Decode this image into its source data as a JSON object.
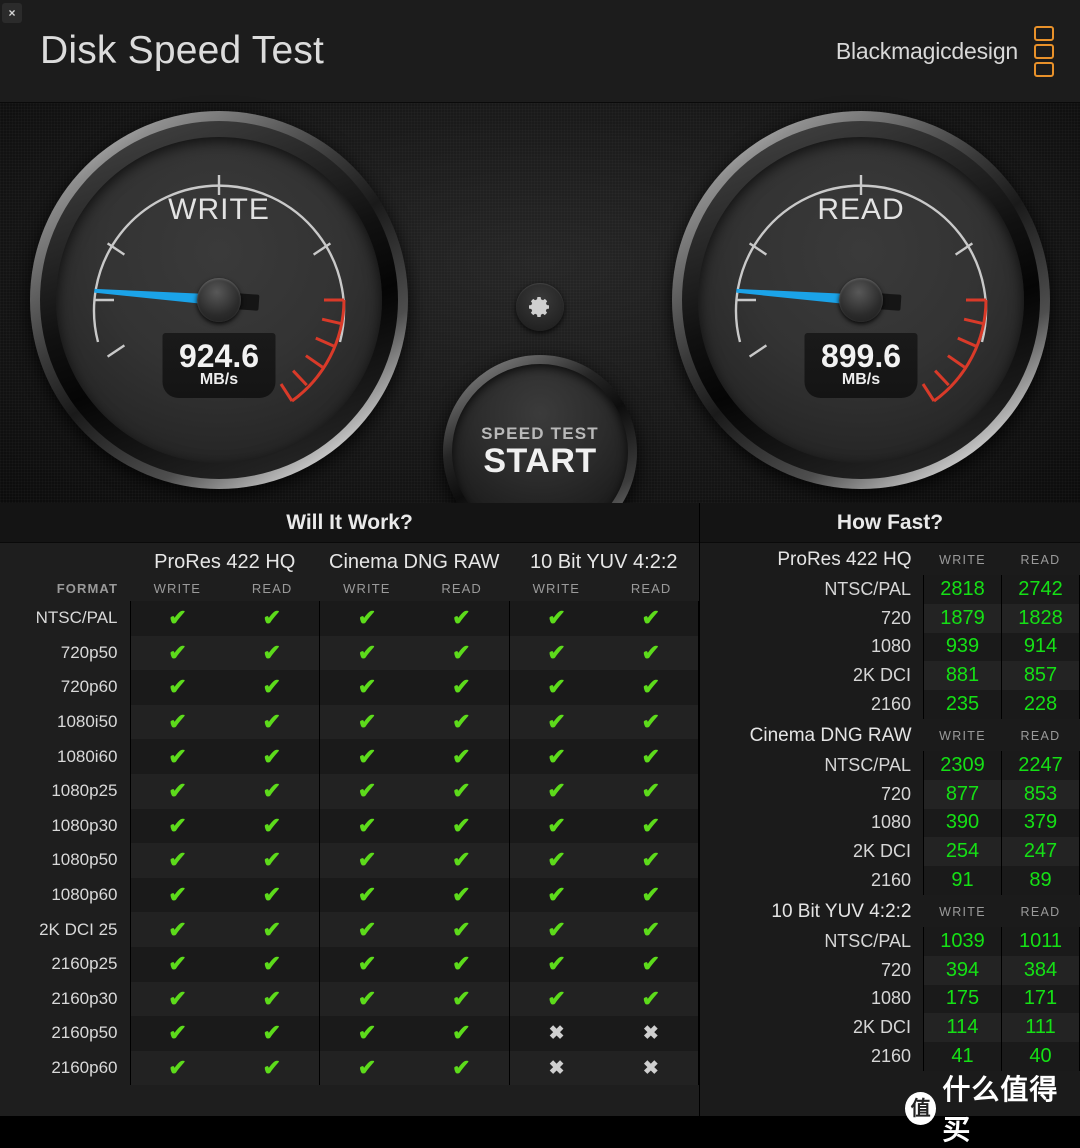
{
  "window": {
    "close_label": "×"
  },
  "header": {
    "title": "Disk Speed Test",
    "brand": "Blackmagicdesign",
    "brand_color": "#e8912a"
  },
  "gauges": {
    "write": {
      "label": "WRITE",
      "value": "924.6",
      "unit": "MB/s",
      "needle_color": "#1ba3e8",
      "needle_angle": 184
    },
    "read": {
      "label": "READ",
      "value": "899.6",
      "unit": "MB/s",
      "needle_color": "#1ba3e8",
      "needle_angle": 184
    }
  },
  "start_button": {
    "sub_label": "SPEED TEST",
    "main_label": "START"
  },
  "settings_button": {
    "icon": "gear-icon"
  },
  "will_it_work": {
    "title": "Will It Work?",
    "format_header": "FORMAT",
    "groups": [
      "ProRes 422 HQ",
      "Cinema DNG RAW",
      "10 Bit YUV 4:2:2"
    ],
    "sub_headers": [
      "WRITE",
      "READ"
    ],
    "check_glyph": "✔",
    "cross_glyph": "✖",
    "rows": [
      {
        "format": "NTSC/PAL",
        "marks": [
          true,
          true,
          true,
          true,
          true,
          true
        ]
      },
      {
        "format": "720p50",
        "marks": [
          true,
          true,
          true,
          true,
          true,
          true
        ]
      },
      {
        "format": "720p60",
        "marks": [
          true,
          true,
          true,
          true,
          true,
          true
        ]
      },
      {
        "format": "1080i50",
        "marks": [
          true,
          true,
          true,
          true,
          true,
          true
        ]
      },
      {
        "format": "1080i60",
        "marks": [
          true,
          true,
          true,
          true,
          true,
          true
        ]
      },
      {
        "format": "1080p25",
        "marks": [
          true,
          true,
          true,
          true,
          true,
          true
        ]
      },
      {
        "format": "1080p30",
        "marks": [
          true,
          true,
          true,
          true,
          true,
          true
        ]
      },
      {
        "format": "1080p50",
        "marks": [
          true,
          true,
          true,
          true,
          true,
          true
        ]
      },
      {
        "format": "1080p60",
        "marks": [
          true,
          true,
          true,
          true,
          true,
          true
        ]
      },
      {
        "format": "2K DCI 25",
        "marks": [
          true,
          true,
          true,
          true,
          true,
          true
        ]
      },
      {
        "format": "2160p25",
        "marks": [
          true,
          true,
          true,
          true,
          true,
          true
        ]
      },
      {
        "format": "2160p30",
        "marks": [
          true,
          true,
          true,
          true,
          true,
          true
        ]
      },
      {
        "format": "2160p50",
        "marks": [
          true,
          true,
          true,
          true,
          false,
          false
        ]
      },
      {
        "format": "2160p60",
        "marks": [
          true,
          true,
          true,
          true,
          false,
          false
        ]
      }
    ]
  },
  "how_fast": {
    "title": "How Fast?",
    "sub_headers": [
      "WRITE",
      "READ"
    ],
    "blocks": [
      {
        "name": "ProRes 422 HQ",
        "rows": [
          {
            "label": "NTSC/PAL",
            "write": "2818",
            "read": "2742"
          },
          {
            "label": "720",
            "write": "1879",
            "read": "1828"
          },
          {
            "label": "1080",
            "write": "939",
            "read": "914"
          },
          {
            "label": "2K DCI",
            "write": "881",
            "read": "857"
          },
          {
            "label": "2160",
            "write": "235",
            "read": "228"
          }
        ]
      },
      {
        "name": "Cinema DNG RAW",
        "rows": [
          {
            "label": "NTSC/PAL",
            "write": "2309",
            "read": "2247"
          },
          {
            "label": "720",
            "write": "877",
            "read": "853"
          },
          {
            "label": "1080",
            "write": "390",
            "read": "379"
          },
          {
            "label": "2K DCI",
            "write": "254",
            "read": "247"
          },
          {
            "label": "2160",
            "write": "91",
            "read": "89"
          }
        ]
      },
      {
        "name": "10 Bit YUV 4:2:2",
        "rows": [
          {
            "label": "NTSC/PAL",
            "write": "1039",
            "read": "1011"
          },
          {
            "label": "720",
            "write": "394",
            "read": "384"
          },
          {
            "label": "1080",
            "write": "175",
            "read": "171"
          },
          {
            "label": "2K DCI",
            "write": "114",
            "read": "111"
          },
          {
            "label": "2160",
            "write": "41",
            "read": "40"
          }
        ]
      }
    ]
  },
  "watermark": {
    "badge": "值",
    "text": "什么值得买"
  }
}
